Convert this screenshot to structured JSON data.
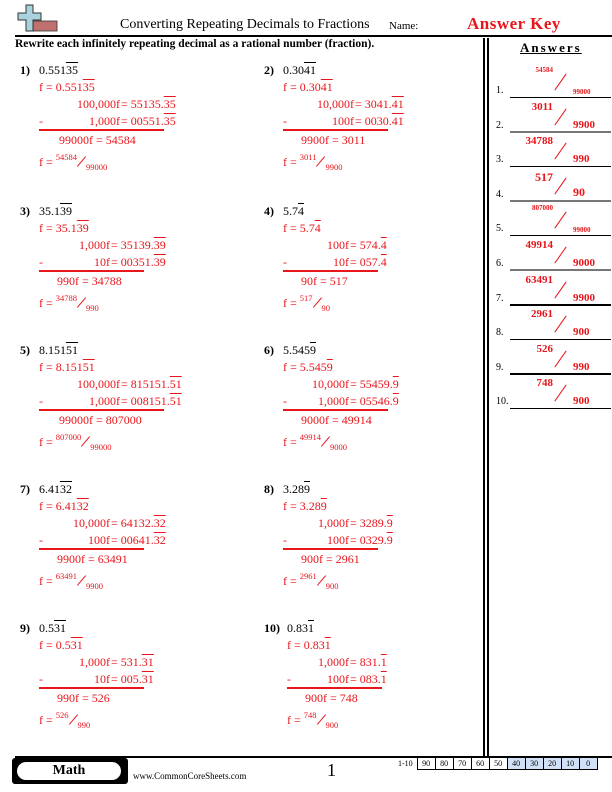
{
  "header": {
    "logo_icon": "plus-sign-logo-icon",
    "title": "Converting Repeating Decimals to Fractions",
    "name_label": "Name:",
    "name_value": "Answer Key"
  },
  "instructions": "Rewrite each infinitely repeating decimal as a rational number (fraction).",
  "problems": [
    {
      "num": "1)",
      "q_plain": "0.551",
      "q_rep": "35",
      "f_plain": "f = 0.551",
      "f_rep": "35",
      "m1": "100,000f",
      "r1_plain": "= 55135.",
      "r1_rep": "35",
      "m2": "1,000f",
      "r2_plain": "= 00551.",
      "r2_rep": "35",
      "res": "99000f = 54584",
      "f_eq": "f =",
      "num_frac": "54584",
      "den_frac": "99000"
    },
    {
      "num": "2)",
      "q_plain": "0.30",
      "q_rep": "41",
      "f_plain": "f = 0.30",
      "f_rep": "41",
      "m1": "10,000f",
      "r1_plain": "= 3041.",
      "r1_rep": "41",
      "m2": "100f",
      "r2_plain": "= 0030.",
      "r2_rep": "41",
      "res": "9900f = 3011",
      "f_eq": "f =",
      "num_frac": "3011",
      "den_frac": "9900"
    },
    {
      "num": "3)",
      "q_plain": "35.1",
      "q_rep": "39",
      "f_plain": "f = 35.1",
      "f_rep": "39",
      "m1": "1,000f",
      "r1_plain": "= 35139.",
      "r1_rep": "39",
      "m2": "10f",
      "r2_plain": "= 00351.",
      "r2_rep": "39",
      "res": "990f = 34788",
      "f_eq": "f =",
      "num_frac": "34788",
      "den_frac": "990"
    },
    {
      "num": "4)",
      "q_plain": "5.7",
      "q_rep": "4",
      "f_plain": "f = 5.7",
      "f_rep": "4",
      "m1": "100f",
      "r1_plain": "= 574.",
      "r1_rep": "4",
      "m2": "10f",
      "r2_plain": "= 057.",
      "r2_rep": "4",
      "res": "90f = 517",
      "f_eq": "f =",
      "num_frac": "517",
      "den_frac": "90"
    },
    {
      "num": "5)",
      "q_plain": "8.151",
      "q_rep": "51",
      "f_plain": "f = 8.151",
      "f_rep": "51",
      "m1": "100,000f",
      "r1_plain": "= 815151.",
      "r1_rep": "51",
      "m2": "1,000f",
      "r2_plain": "= 008151.",
      "r2_rep": "51",
      "res": "99000f = 807000",
      "f_eq": "f =",
      "num_frac": "807000",
      "den_frac": "99000"
    },
    {
      "num": "6)",
      "q_plain": "5.545",
      "q_rep": "9",
      "f_plain": "f = 5.545",
      "f_rep": "9",
      "m1": "10,000f",
      "r1_plain": "= 55459.",
      "r1_rep": "9",
      "m2": "1,000f",
      "r2_plain": "= 05546.",
      "r2_rep": "9",
      "res": "9000f = 49914",
      "f_eq": "f =",
      "num_frac": "49914",
      "den_frac": "9000"
    },
    {
      "num": "7)",
      "q_plain": "6.41",
      "q_rep": "32",
      "f_plain": "f = 6.41",
      "f_rep": "32",
      "m1": "10,000f",
      "r1_plain": "= 64132.",
      "r1_rep": "32",
      "m2": "100f",
      "r2_plain": "= 00641.",
      "r2_rep": "32",
      "res": "9900f = 63491",
      "f_eq": "f =",
      "num_frac": "63491",
      "den_frac": "9900"
    },
    {
      "num": "8)",
      "q_plain": "3.28",
      "q_rep": "9",
      "f_plain": "f = 3.28",
      "f_rep": "9",
      "m1": "1,000f",
      "r1_plain": "= 3289.",
      "r1_rep": "9",
      "m2": "100f",
      "r2_plain": "= 0329.",
      "r2_rep": "9",
      "res": "900f = 2961",
      "f_eq": "f =",
      "num_frac": "2961",
      "den_frac": "900"
    },
    {
      "num": "9)",
      "q_plain": "0.5",
      "q_rep": "31",
      "f_plain": "f = 0.5",
      "f_rep": "31",
      "m1": "1,000f",
      "r1_plain": "= 531.",
      "r1_rep": "31",
      "m2": "10f",
      "r2_plain": "= 005.",
      "r2_rep": "31",
      "res": "990f = 526",
      "f_eq": "f =",
      "num_frac": "526",
      "den_frac": "990"
    },
    {
      "num": "10)",
      "q_plain": "0.83",
      "q_rep": "1",
      "f_plain": "f = 0.83",
      "f_rep": "1",
      "m1": "1,000f",
      "r1_plain": "= 831.",
      "r1_rep": "1",
      "m2": "100f",
      "r2_plain": "= 083.",
      "r2_rep": "1",
      "res": "900f = 748",
      "f_eq": "f =",
      "num_frac": "748",
      "den_frac": "900"
    }
  ],
  "minus_sign": "-",
  "answers": {
    "title": "Answers",
    "items": [
      {
        "label": "1.",
        "num": "54584",
        "den": "99000"
      },
      {
        "label": "2.",
        "num": "3011",
        "den": "9900"
      },
      {
        "label": "3.",
        "num": "34788",
        "den": "990"
      },
      {
        "label": "4.",
        "num": "517",
        "den": "90"
      },
      {
        "label": "5.",
        "num": "807000",
        "den": "99000"
      },
      {
        "label": "6.",
        "num": "49914",
        "den": "9000"
      },
      {
        "label": "7.",
        "num": "63491",
        "den": "9900"
      },
      {
        "label": "8.",
        "num": "2961",
        "den": "900"
      },
      {
        "label": "9.",
        "num": "526",
        "den": "990"
      },
      {
        "label": "10.",
        "num": "748",
        "den": "900"
      }
    ]
  },
  "footer": {
    "subject": "Math",
    "website": "www.CommonCoreSheets.com",
    "page_number": "1",
    "score_label": "1-10",
    "scores": [
      "90",
      "80",
      "70",
      "60",
      "50",
      "40",
      "30",
      "20",
      "10",
      "0"
    ],
    "highlighted_scores": [
      "40",
      "30",
      "20",
      "10",
      "0"
    ]
  },
  "colors": {
    "answer_red": "#e8151b",
    "score_highlight": "#cfe0f7"
  }
}
